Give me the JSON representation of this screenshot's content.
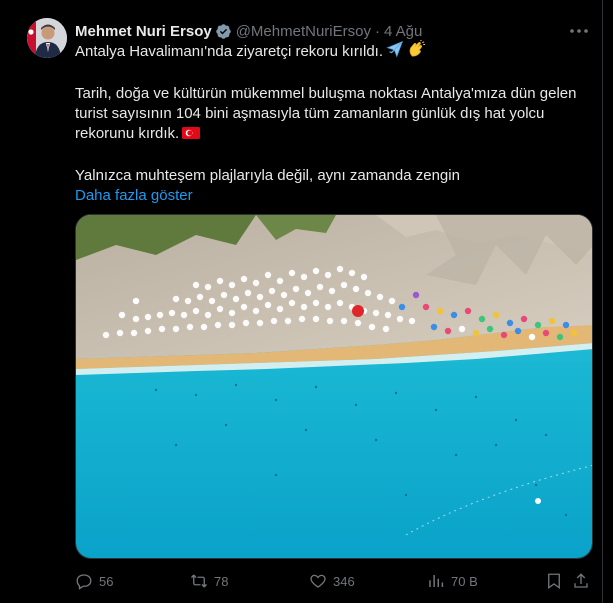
{
  "author": {
    "name": "Mehmet Nuri Ersoy",
    "handle": "@MehmetNuriErsoy",
    "separator": "·",
    "date": "4 Ağu"
  },
  "post": {
    "line1": "Antalya Havalimanı'nda ziyaretçi rekoru kırıldı.",
    "line2": "Tarih, doğa ve kültürün mükemmel buluşma noktası Antalya'mıza dün gelen",
    "line3": "turist sayısının 104 bini aşmasıyla tüm zamanların günlük dış hat yolcu",
    "line4": "rekorunu kırdık.",
    "line5": "Yalnızca muhteşem plajlarıyla değil, aynı zamanda zengin",
    "show_more": "Daha fazla göster"
  },
  "emojis": [
    "airplane-emoji",
    "clapping-hands-emoji",
    "turkey-flag-emoji"
  ],
  "actions": {
    "replies": "56",
    "reposts": "78",
    "likes": "346",
    "views": "70 B"
  },
  "colors": {
    "background": "#000000",
    "text": "#e7e9ea",
    "muted": "#71767b",
    "link": "#1d9bf0",
    "verified": "#829aab"
  }
}
